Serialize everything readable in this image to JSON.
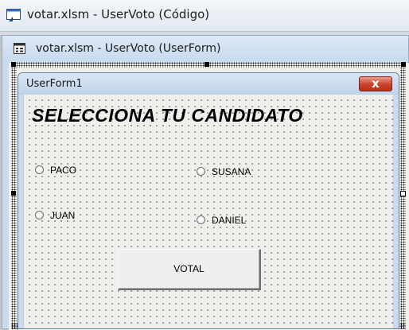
{
  "code_window": {
    "title": "votar.xlsm - UserVoto (Código)",
    "icon": "vba-code-window-icon"
  },
  "designer_window": {
    "title": "votar.xlsm - UserVoto (UserForm)",
    "icon": "userform-designer-icon"
  },
  "userform": {
    "caption": "UserForm1",
    "close_label": "x",
    "heading": "SELECCIONA TU CANDIDATO",
    "options": [
      {
        "label": "PACO"
      },
      {
        "label": "SUSANA"
      },
      {
        "label": "JUAN"
      },
      {
        "label": "DANIEL"
      }
    ],
    "vote_button_label": "VOTAL"
  },
  "colors": {
    "close_button": "#c8432c",
    "designer_background": "#c9dcef",
    "form_background": "#f0efeb"
  }
}
